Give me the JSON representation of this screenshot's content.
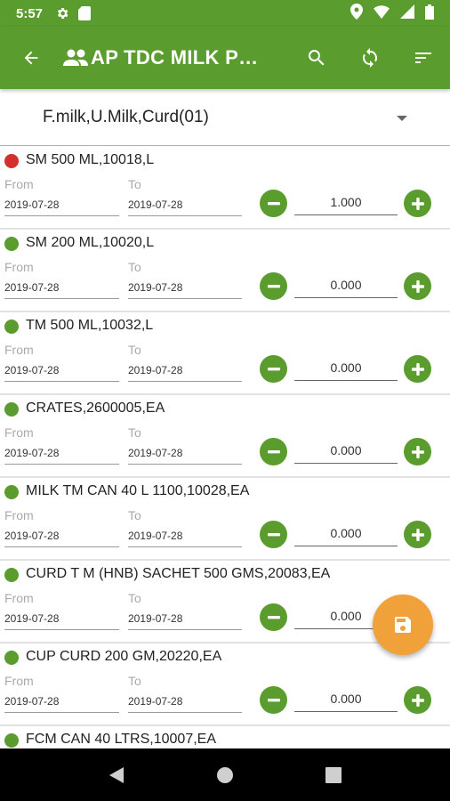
{
  "status_bar": {
    "time": "5:57",
    "icons": [
      "gear-icon",
      "sd-card-icon",
      "location-icon",
      "wifi-icon",
      "signal-icon",
      "battery-icon"
    ]
  },
  "app_bar": {
    "title": "AP TDC MILK PRODUCTS",
    "icons": [
      "back-arrow-icon",
      "group-icon",
      "search-icon",
      "sync-icon",
      "sort-icon"
    ]
  },
  "spinner": {
    "selected": "F.milk,U.Milk,Curd(01)"
  },
  "labels": {
    "from": "From",
    "to": "To"
  },
  "items": [
    {
      "name": "SM 500 ML,10018,L",
      "status": "red",
      "from": "2019-07-28",
      "to": "2019-07-28",
      "qty": "1.000"
    },
    {
      "name": "SM 200 ML,10020,L",
      "status": "green",
      "from": "2019-07-28",
      "to": "2019-07-28",
      "qty": "0.000"
    },
    {
      "name": "TM 500 ML,10032,L",
      "status": "green",
      "from": "2019-07-28",
      "to": "2019-07-28",
      "qty": "0.000"
    },
    {
      "name": "CRATES,2600005,EA",
      "status": "green",
      "from": "2019-07-28",
      "to": "2019-07-28",
      "qty": "0.000"
    },
    {
      "name": "MILK TM CAN 40 L 1100,10028,EA",
      "status": "green",
      "from": "2019-07-28",
      "to": "2019-07-28",
      "qty": "0.000"
    },
    {
      "name": "CURD T M (HNB) SACHET 500 GMS,20083,EA",
      "status": "green",
      "from": "2019-07-28",
      "to": "2019-07-28",
      "qty": "0.000"
    },
    {
      "name": "CUP CURD 200 GM,20220,EA",
      "status": "green",
      "from": "2019-07-28",
      "to": "2019-07-28",
      "qty": "0.000"
    },
    {
      "name": "FCM CAN 40 LTRS,10007,EA",
      "status": "green",
      "from": "",
      "to": "",
      "qty": ""
    }
  ],
  "colors": {
    "primary": "#5a9d2e",
    "accent": "#f0a13a",
    "alert": "#d32f2f"
  }
}
